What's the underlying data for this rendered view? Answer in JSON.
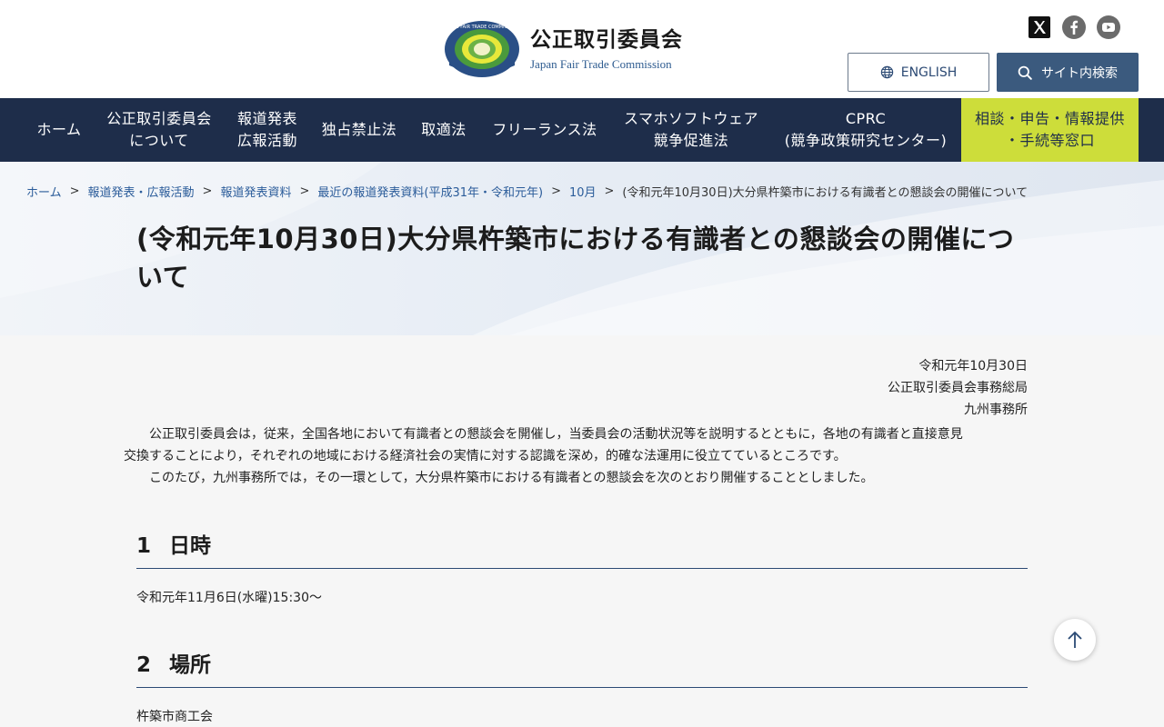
{
  "header": {
    "logo_jp": "公正取引委員会",
    "logo_en": "Japan Fair Trade Commission",
    "logo_ring_text": "JAPAN FAIR TRADE COMMISSION",
    "english_label": "ENGLISH",
    "search_label": "サイト内検索",
    "sns": [
      {
        "name": "x-icon",
        "label": "X"
      },
      {
        "name": "facebook-icon",
        "label": "Facebook"
      },
      {
        "name": "youtube-icon",
        "label": "YouTube"
      }
    ]
  },
  "nav": {
    "items": [
      {
        "lines": [
          "ホーム"
        ]
      },
      {
        "lines": [
          "公正取引委員会",
          "について"
        ]
      },
      {
        "lines": [
          "報道発表",
          "広報活動"
        ]
      },
      {
        "lines": [
          "独占禁止法"
        ]
      },
      {
        "lines": [
          "取適法"
        ]
      },
      {
        "lines": [
          "フリーランス法"
        ]
      },
      {
        "lines": [
          "スマホソフトウェア",
          "競争促進法"
        ]
      },
      {
        "lines": [
          "CPRC",
          "(競争政策研究センター)"
        ]
      },
      {
        "lines": [
          "相談・申告・情報提供",
          "・手続等窓口"
        ]
      }
    ]
  },
  "breadcrumb": {
    "items": [
      "ホーム",
      "報道発表・広報活動",
      "報道発表資料",
      "最近の報道発表資料(平成31年・令和元年)",
      "10月"
    ],
    "current": "(令和元年10月30日)大分県杵築市における有識者との懇談会の開催について",
    "separator": ">"
  },
  "page": {
    "title_line1": "(令和元年10月30日)大分県杵築市における有識者との懇談会の開催につ",
    "title_line2": "いて"
  },
  "meta": {
    "date": "令和元年10月30日",
    "org1": "公正取引委員会事務総局",
    "org2": "九州事務所"
  },
  "intro": {
    "p1_line1": "公正取引委員会は，従来，全国各地において有識者との懇談会を開催し，当委員会の活動状況等を説明するとともに，各地の有識者と直接意見",
    "p1_line2": "交換することにより，それぞれの地域における経済社会の実情に対する認識を深め，的確な法運用に役立てているところです。",
    "p2": "このたび，九州事務所では，その一環として，大分県杵築市における有識者との懇談会を次のとおり開催することとしました。"
  },
  "sections": [
    {
      "num": "1",
      "title": "日時",
      "body": "令和元年11月6日(水曜)15:30〜"
    },
    {
      "num": "2",
      "title": "場所",
      "body": "杵築市商工会"
    }
  ],
  "colors": {
    "navy": "#1e2d4a",
    "accent_lime": "#cddd3a",
    "search_button": "#3b5a7e",
    "link": "#2b5c9a"
  }
}
